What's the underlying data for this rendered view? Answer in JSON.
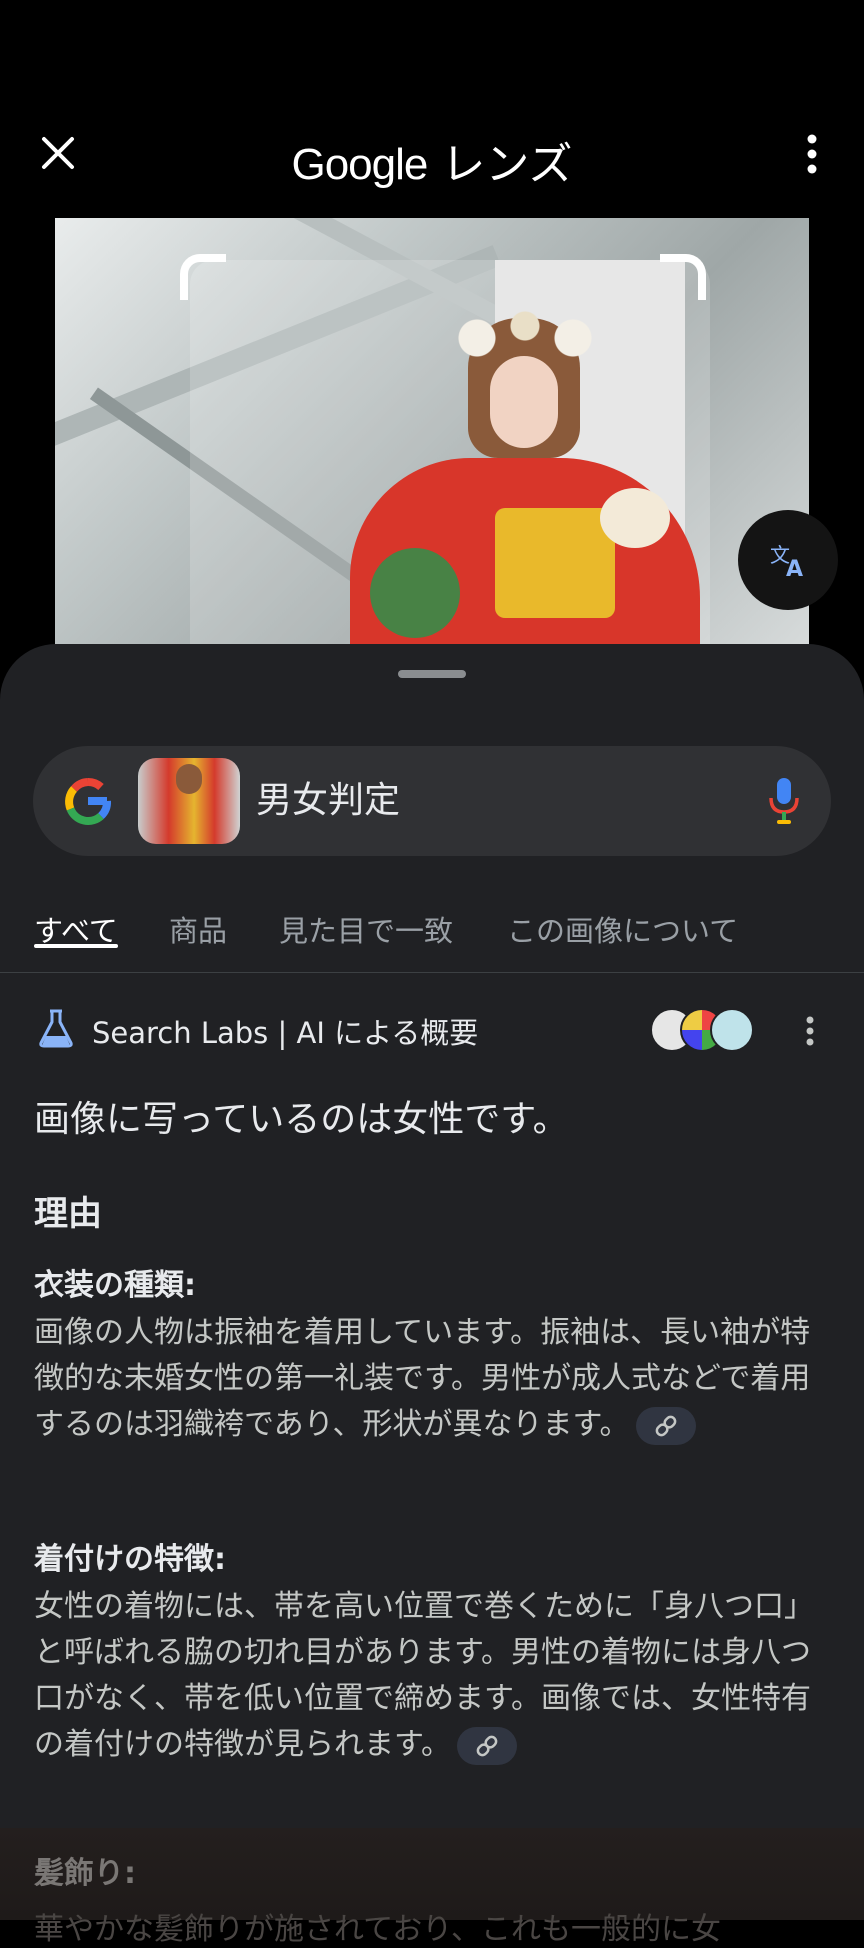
{
  "header": {
    "title_google": "Google",
    "title_lens": "レンズ"
  },
  "search": {
    "query": "男女判定"
  },
  "tabs": [
    {
      "label": "すべて",
      "active": true
    },
    {
      "label": "商品",
      "active": false
    },
    {
      "label": "見た目で一致",
      "active": false
    },
    {
      "label": "この画像について",
      "active": false
    }
  ],
  "ai_overview": {
    "header": "Search Labs | AI による概要",
    "answer": "画像に写っているのは女性です。",
    "reason_heading": "理由",
    "sections": [
      {
        "title": "衣装の種類:",
        "body": "画像の人物は振袖を着用しています。振袖は、長い袖が特徴的な未婚女性の第一礼装です。男性が成人式などで着用するのは羽織袴であり、形状が異なります。"
      },
      {
        "title": "着付けの特徴:",
        "body": "女性の着物には、帯を高い位置で巻くために「身八つ口」と呼ばれる脇の切れ目があります。男性の着物には身八つ口がなく、帯を低い位置で締めます。画像では、女性特有の着付けの特徴が見られます。"
      },
      {
        "title": "髪飾り:",
        "body": "華やかな髪飾りが施されており、これも一般的に女"
      }
    ]
  },
  "colors": {
    "background": "#000000",
    "sheet": "#202124",
    "search_bar": "#303134",
    "text_primary": "#e8eaed",
    "text_secondary": "#9aa0a6",
    "accent_blue": "#8ab4f8"
  }
}
